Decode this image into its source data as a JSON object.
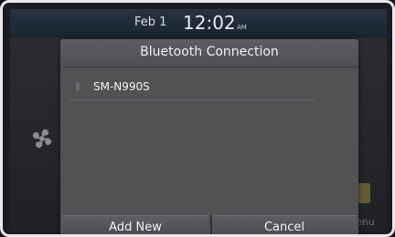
{
  "status_bar": {
    "date": "Feb  1",
    "time": "12:02",
    "ampm": "AM"
  },
  "background": {
    "menu_label": "enu"
  },
  "dialog": {
    "title": "Bluetooth Connection",
    "devices": [
      {
        "name": "SM-N990S"
      }
    ],
    "buttons": {
      "add_new": "Add New",
      "cancel": "Cancel"
    }
  },
  "icons": [
    "fan-icon",
    "device-indicator-icon"
  ],
  "colors": {
    "dialog_bg": "#505254",
    "statusbar_bg": "#273344"
  }
}
